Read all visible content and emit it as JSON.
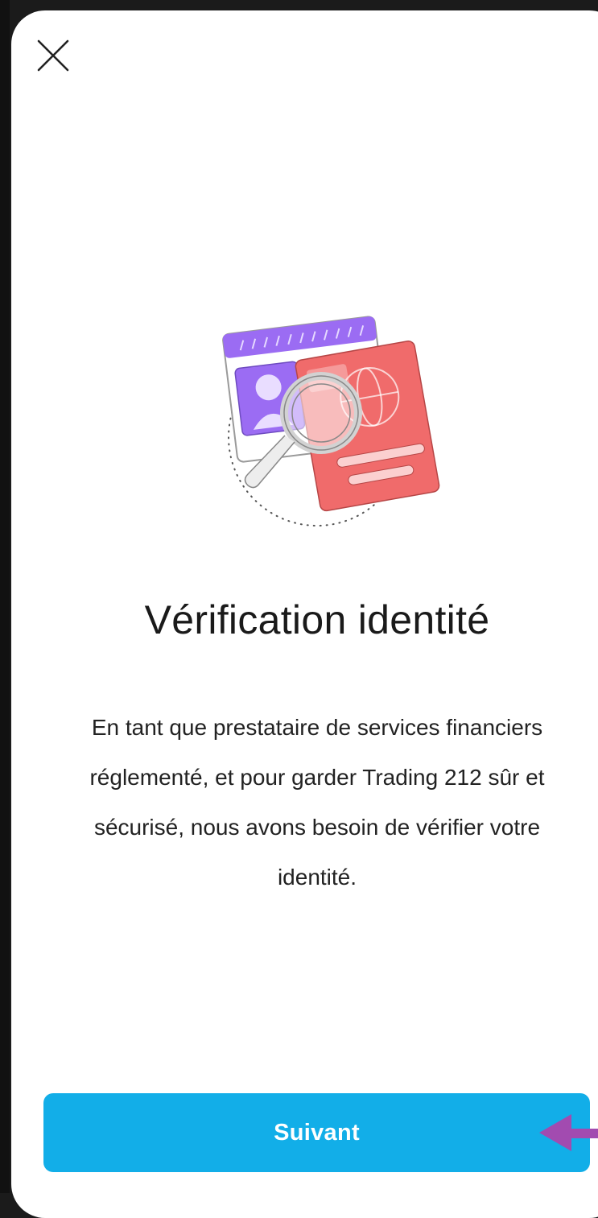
{
  "header": {
    "close_icon": "close-icon"
  },
  "illustration": {
    "icon": "identity-verification-illustration",
    "colors": {
      "purple": "#9b6cf3",
      "purple_light": "#c7b0fa",
      "red": "#f06b6b",
      "red_light": "#f9b5b5"
    }
  },
  "main": {
    "title": "Vérification identité",
    "body_lines": [
      "En tant que prestataire de services financiers",
      "réglementé, et pour garder Trading 212 sûr et",
      "sécurisé, nous avons besoin de vérifier votre",
      "identité."
    ]
  },
  "footer": {
    "next_label": "Suivant",
    "button_color": "#12aee8"
  },
  "overlay": {
    "pointer_icon": "pointer-arrow-icon",
    "pointer_color": "#a24bb0"
  }
}
